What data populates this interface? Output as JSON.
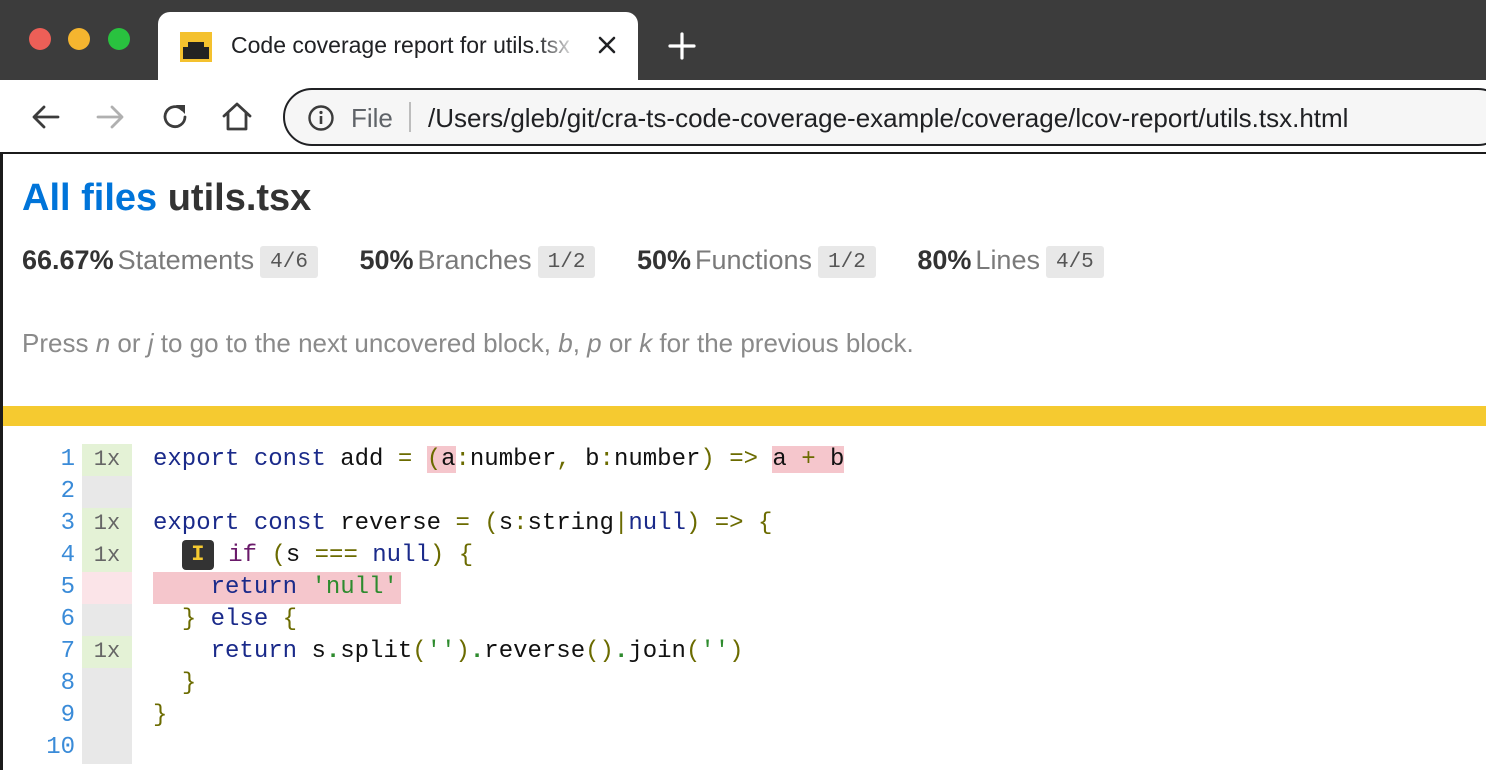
{
  "browser": {
    "tab_title": "Code coverage report for utils.tsx",
    "address_scheme": "File",
    "address_url": "/Users/gleb/git/cra-ts-code-coverage-example/coverage/lcov-report/utils.tsx.html",
    "icons": [
      "back-arrow-icon",
      "forward-arrow-icon",
      "reload-icon",
      "home-icon",
      "info-icon",
      "close-icon",
      "plus-icon"
    ],
    "traffic_light_colors": [
      "#ed5f57",
      "#f5b52f",
      "#29c23f"
    ]
  },
  "report": {
    "breadcrumb_root": "All files",
    "file_name": "utils.tsx",
    "stats": [
      {
        "pct": "66.67%",
        "label": "Statements",
        "fraction": "4/6"
      },
      {
        "pct": "50%",
        "label": "Branches",
        "fraction": "1/2"
      },
      {
        "pct": "50%",
        "label": "Functions",
        "fraction": "1/2"
      },
      {
        "pct": "80%",
        "label": "Lines",
        "fraction": "4/5"
      }
    ],
    "hint": {
      "p1": "Press ",
      "k1": "n",
      "p2": " or ",
      "k2": "j",
      "p3": " to go to the next uncovered block, ",
      "k3": "b",
      "p4": ", ",
      "k4": "p",
      "p5": " or ",
      "k5": "k",
      "p6": " for the previous block."
    },
    "status_color": "#f5ca30"
  },
  "code": {
    "line_numbers": [
      "1",
      "2",
      "3",
      "4",
      "5",
      "6",
      "7",
      "8",
      "9",
      "10"
    ],
    "hits": [
      "1x",
      "",
      "1x",
      "1x",
      "",
      "",
      "1x",
      "",
      "",
      ""
    ],
    "tokens": {
      "export": "export",
      "const": "const",
      "add": "add",
      "eq": "=",
      "lp": "(",
      "rp": ")",
      "a": "a",
      "colon": ":",
      "number": "number",
      "comma": ",",
      "b": "b",
      "arrow": "=>",
      "plus": "+",
      "reverse": "reverse",
      "s": "s",
      "string": "string",
      "pipe": "|",
      "null": "null",
      "lbrace": "{",
      "rbrace": "}",
      "if": "if",
      "triple_eq": "===",
      "return": "return",
      "null_str": "'null'",
      "else": "else",
      "split": "split",
      "dot": ".",
      "empty_str": "''",
      "join": "join",
      "branch_badge": "I"
    }
  }
}
